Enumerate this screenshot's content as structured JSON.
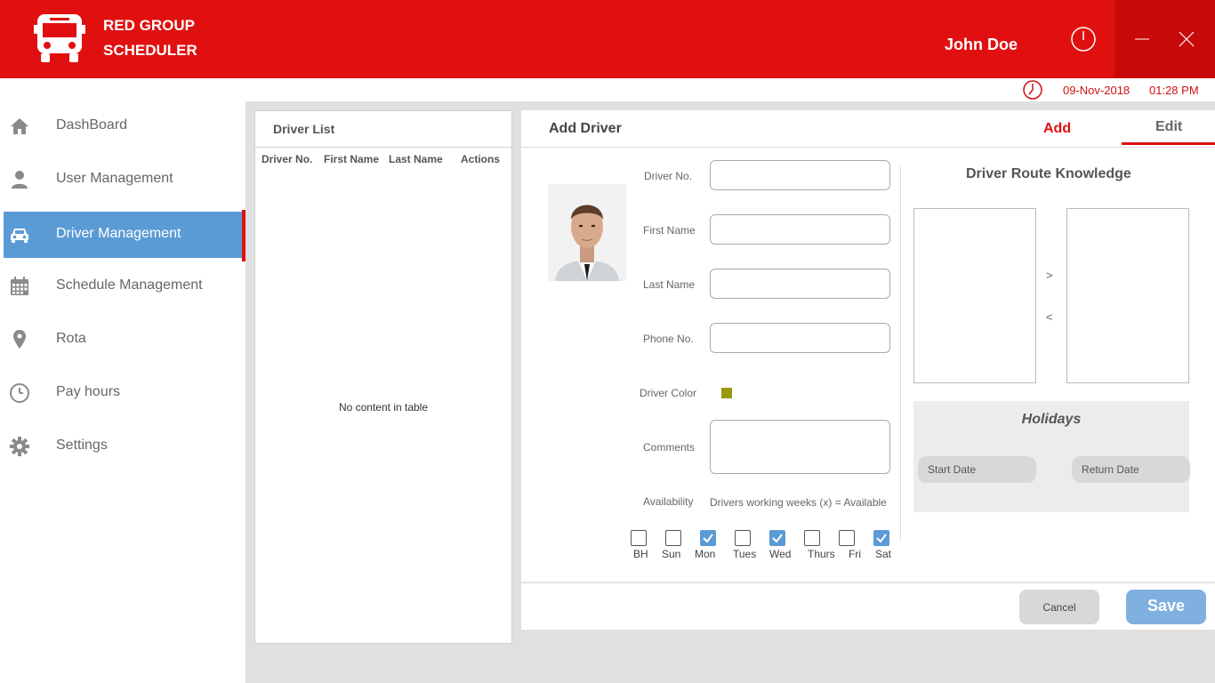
{
  "app": {
    "title_line1": "RED GROUP",
    "title_line2": "SCHEDULER",
    "logo_icon": "bus-icon",
    "user_name": "John Doe",
    "brand_color": "#e01010"
  },
  "datetime": {
    "date": "09-Nov-2018",
    "time": "01:28 PM"
  },
  "sidebar": {
    "items": [
      {
        "label": "DashBoard",
        "icon": "home-icon"
      },
      {
        "label": "User Management",
        "icon": "user-icon"
      },
      {
        "label": "Driver Management",
        "icon": "car-icon",
        "active": true
      },
      {
        "label": "Schedule Management",
        "icon": "calendar-icon"
      },
      {
        "label": "Rota",
        "icon": "map-pin-icon"
      },
      {
        "label": "Pay hours",
        "icon": "clock-icon"
      },
      {
        "label": "Settings",
        "icon": "gear-icon"
      }
    ]
  },
  "driver_list": {
    "title": "Driver List",
    "columns": [
      "Driver No.",
      "First Name",
      "Last Name",
      "Actions"
    ],
    "empty_message": "No content in table"
  },
  "add_driver": {
    "title": "Add Driver",
    "tabs": {
      "add": "Add",
      "edit": "Edit"
    },
    "fields": {
      "driver_no": {
        "label": "Driver No.",
        "value": ""
      },
      "first_name": {
        "label": "First Name",
        "value": ""
      },
      "last_name": {
        "label": "Last Name",
        "value": ""
      },
      "phone_no": {
        "label": "Phone No.",
        "value": ""
      },
      "driver_color": {
        "label": "Driver Color",
        "value": "#9a9a10"
      },
      "comments": {
        "label": "Comments",
        "value": ""
      },
      "availability": {
        "label": "Availability",
        "note": "Drivers working weeks (x) = Available"
      }
    },
    "days": [
      {
        "label": "BH",
        "checked": false
      },
      {
        "label": "Sun",
        "checked": false
      },
      {
        "label": "Mon",
        "checked": true
      },
      {
        "label": "Tues",
        "checked": false
      },
      {
        "label": "Wed",
        "checked": true
      },
      {
        "label": "Thurs",
        "checked": false
      },
      {
        "label": "Fri",
        "checked": false
      },
      {
        "label": "Sat",
        "checked": true
      }
    ],
    "route_knowledge": {
      "title": "Driver Route Knowledge",
      "move_right": ">",
      "move_left": "<"
    },
    "holidays": {
      "title": "Holidays",
      "start_date_placeholder": "Start Date",
      "return_date_placeholder": "Return Date"
    },
    "buttons": {
      "cancel": "Cancel",
      "save": "Save"
    }
  }
}
